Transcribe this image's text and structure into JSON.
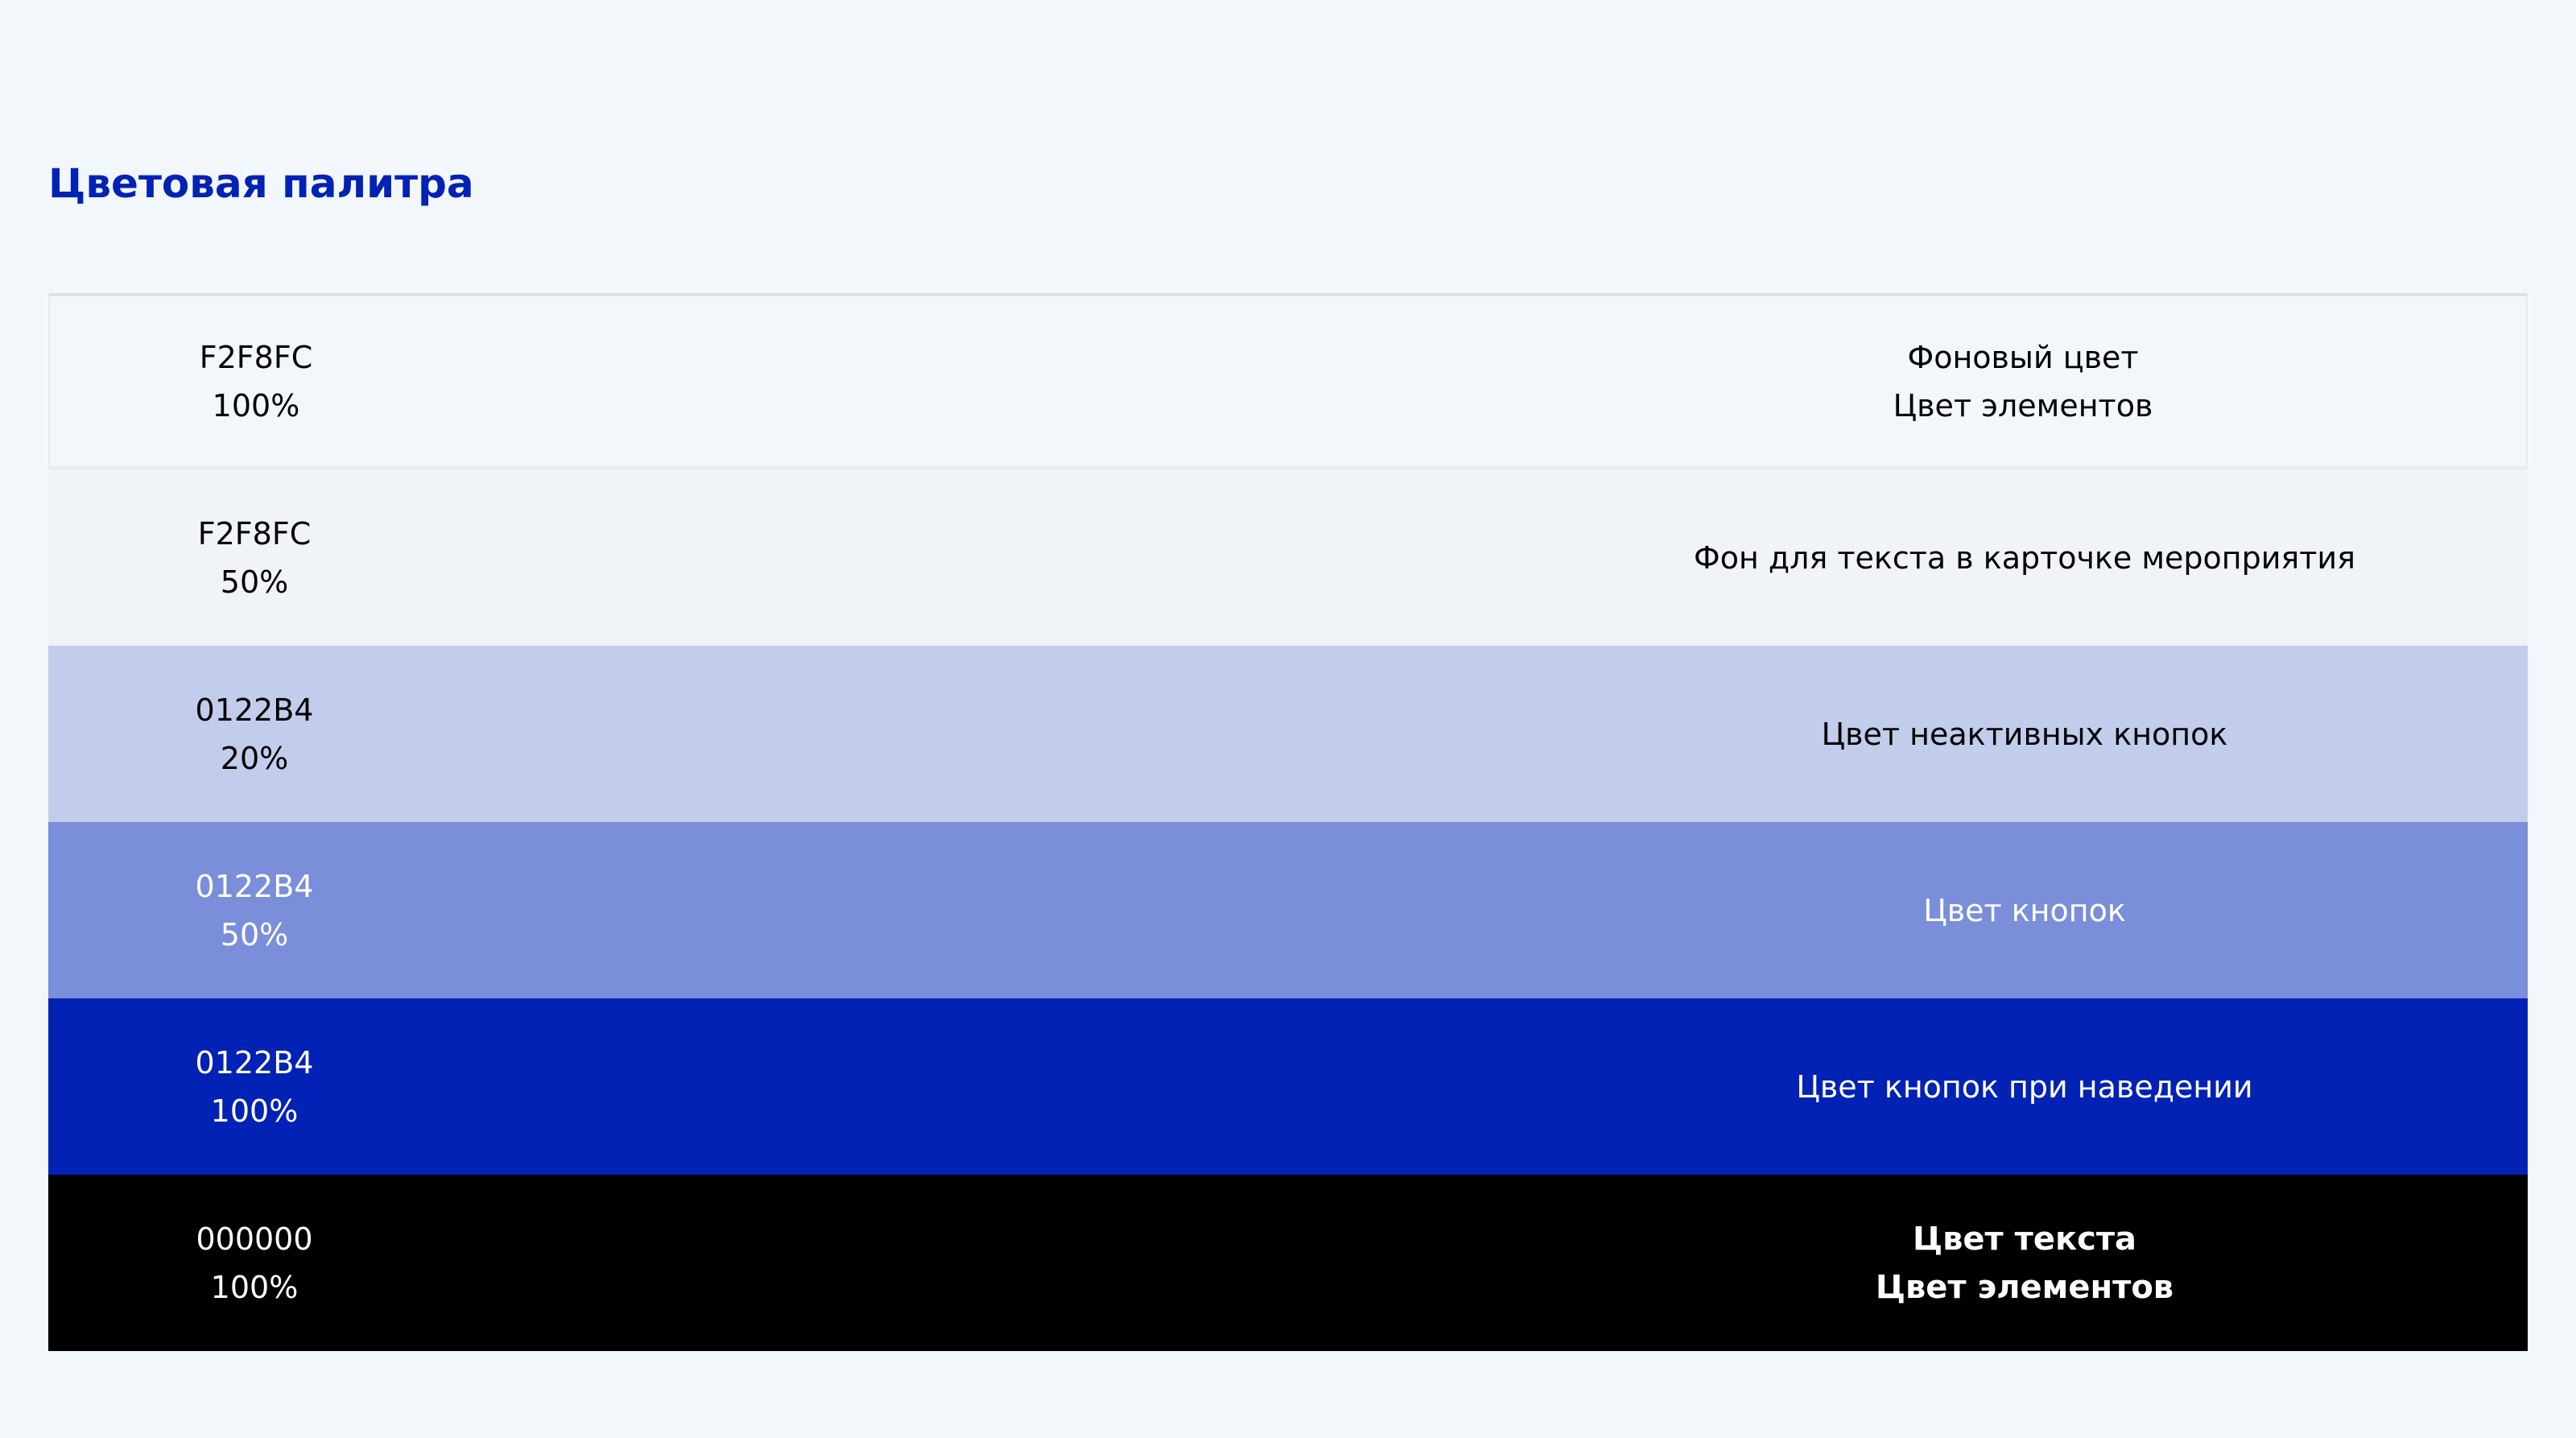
{
  "title": "Цветовая палитра",
  "colors": {
    "page_background": "#F2F7FC",
    "title_color": "#0122B4"
  },
  "palette": [
    {
      "hex": "F2F8FC",
      "opacity": "100%",
      "fill": "#F2F7FC",
      "text_color": "#000000",
      "description": [
        "Фоновый цвет",
        "Цвет элементов"
      ],
      "bold": false
    },
    {
      "hex": "F2F8FC",
      "opacity": "50%",
      "fill": "#F0F4F8",
      "text_color": "#000000",
      "description": [
        "Фон для текста в карточке мероприятия"
      ],
      "bold": false
    },
    {
      "hex": "0122B4",
      "opacity": "20%",
      "fill": "#C2CDEC",
      "text_color": "#000000",
      "description": [
        "Цвет неактивных кнопок"
      ],
      "bold": false
    },
    {
      "hex": "0122B4",
      "opacity": "50%",
      "fill": "#7A8ED9",
      "text_color": "#FFFFFF",
      "description": [
        "Цвет кнопок"
      ],
      "bold": false
    },
    {
      "hex": "0122B4",
      "opacity": "100%",
      "fill": "#0122B4",
      "text_color": "#FFFFFF",
      "description": [
        "Цвет кнопок при наведении"
      ],
      "bold": false
    },
    {
      "hex": "000000",
      "opacity": "100%",
      "fill": "#000000",
      "text_color": "#FFFFFF",
      "description": [
        "Цвет текста",
        "Цвет элементов"
      ],
      "bold": true
    }
  ]
}
